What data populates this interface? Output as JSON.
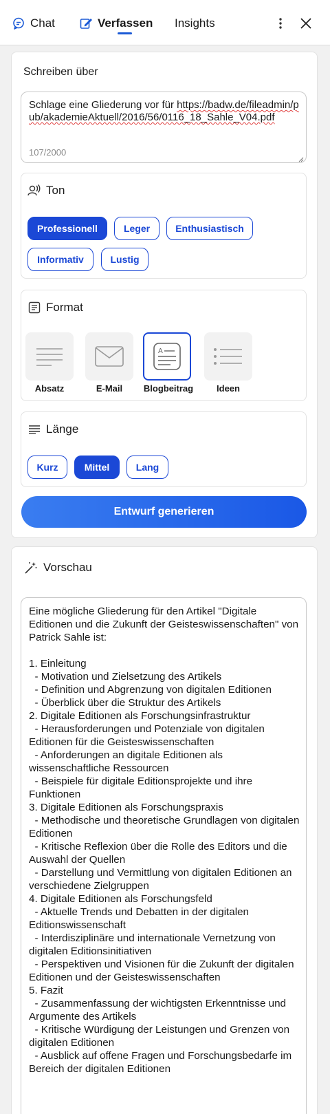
{
  "header": {
    "tabs": [
      {
        "label": "Chat",
        "icon": "chat-bubble-icon"
      },
      {
        "label": "Verfassen",
        "icon": "edit-icon",
        "active": true
      },
      {
        "label": "Insights"
      }
    ],
    "menu_icon": "more-vertical-icon",
    "close_icon": "close-icon"
  },
  "compose": {
    "section_label": "Schreiben über",
    "input_prefix": "Schlage eine Gliederung vor für ",
    "input_url": "https://badw.de/fileadmin/pub/akademieAktuell/2016/56/0116_18_Sahle_V04.pdf",
    "counter": "107/2000"
  },
  "tone": {
    "title": "Ton",
    "options": [
      "Professionell",
      "Leger",
      "Enthusiastisch",
      "Informativ",
      "Lustig"
    ],
    "selected": "Professionell"
  },
  "format": {
    "title": "Format",
    "options": [
      "Absatz",
      "E-Mail",
      "Blogbeitrag",
      "Ideen"
    ],
    "selected": "Blogbeitrag"
  },
  "length": {
    "title": "Länge",
    "options": [
      "Kurz",
      "Mittel",
      "Lang"
    ],
    "selected": "Mittel"
  },
  "generate_label": "Entwurf generieren",
  "preview": {
    "title": "Vorschau",
    "text": "Eine mögliche Gliederung für den Artikel \"Digitale Editionen und die Zukunft der Geisteswissenschaften\" von Patrick Sahle ist:\n\n1. Einleitung\n  - Motivation und Zielsetzung des Artikels\n  - Definition und Abgrenzung von digitalen Editionen\n  - Überblick über die Struktur des Artikels\n2. Digitale Editionen als Forschungsinfrastruktur\n  - Herausforderungen und Potenziale von digitalen Editionen für die Geisteswissenschaften\n  - Anforderungen an digitale Editionen als wissenschaftliche Ressourcen\n  - Beispiele für digitale Editionsprojekte und ihre Funktionen\n3. Digitale Editionen als Forschungspraxis\n  - Methodische und theoretische Grundlagen von digitalen Editionen\n  - Kritische Reflexion über die Rolle des Editors und die Auswahl der Quellen\n  - Darstellung und Vermittlung von digitalen Editionen an verschiedene Zielgruppen\n4. Digitale Editionen als Forschungsfeld\n  - Aktuelle Trends und Debatten in der digitalen Editionswissenschaft\n  - Interdisziplinäre und internationale Vernetzung von digitalen Editionsinitiativen\n  - Perspektiven und Visionen für die Zukunft der digitalen Editionen und der Geisteswissenschaften\n5. Fazit\n  - Zusammenfassung der wichtigsten Erkenntnisse und Argumente des Artikels\n  - Kritische Würdigung der Leistungen und Grenzen von digitalen Editionen\n  - Ausblick auf offene Fragen und Forschungsbedarfe im Bereich der digitalen Editionen"
  },
  "colors": {
    "accent": "#1b48d6",
    "button_gradient_start": "#3a7df0",
    "button_gradient_end": "#1a58e6",
    "background": "#f1f1f1"
  }
}
